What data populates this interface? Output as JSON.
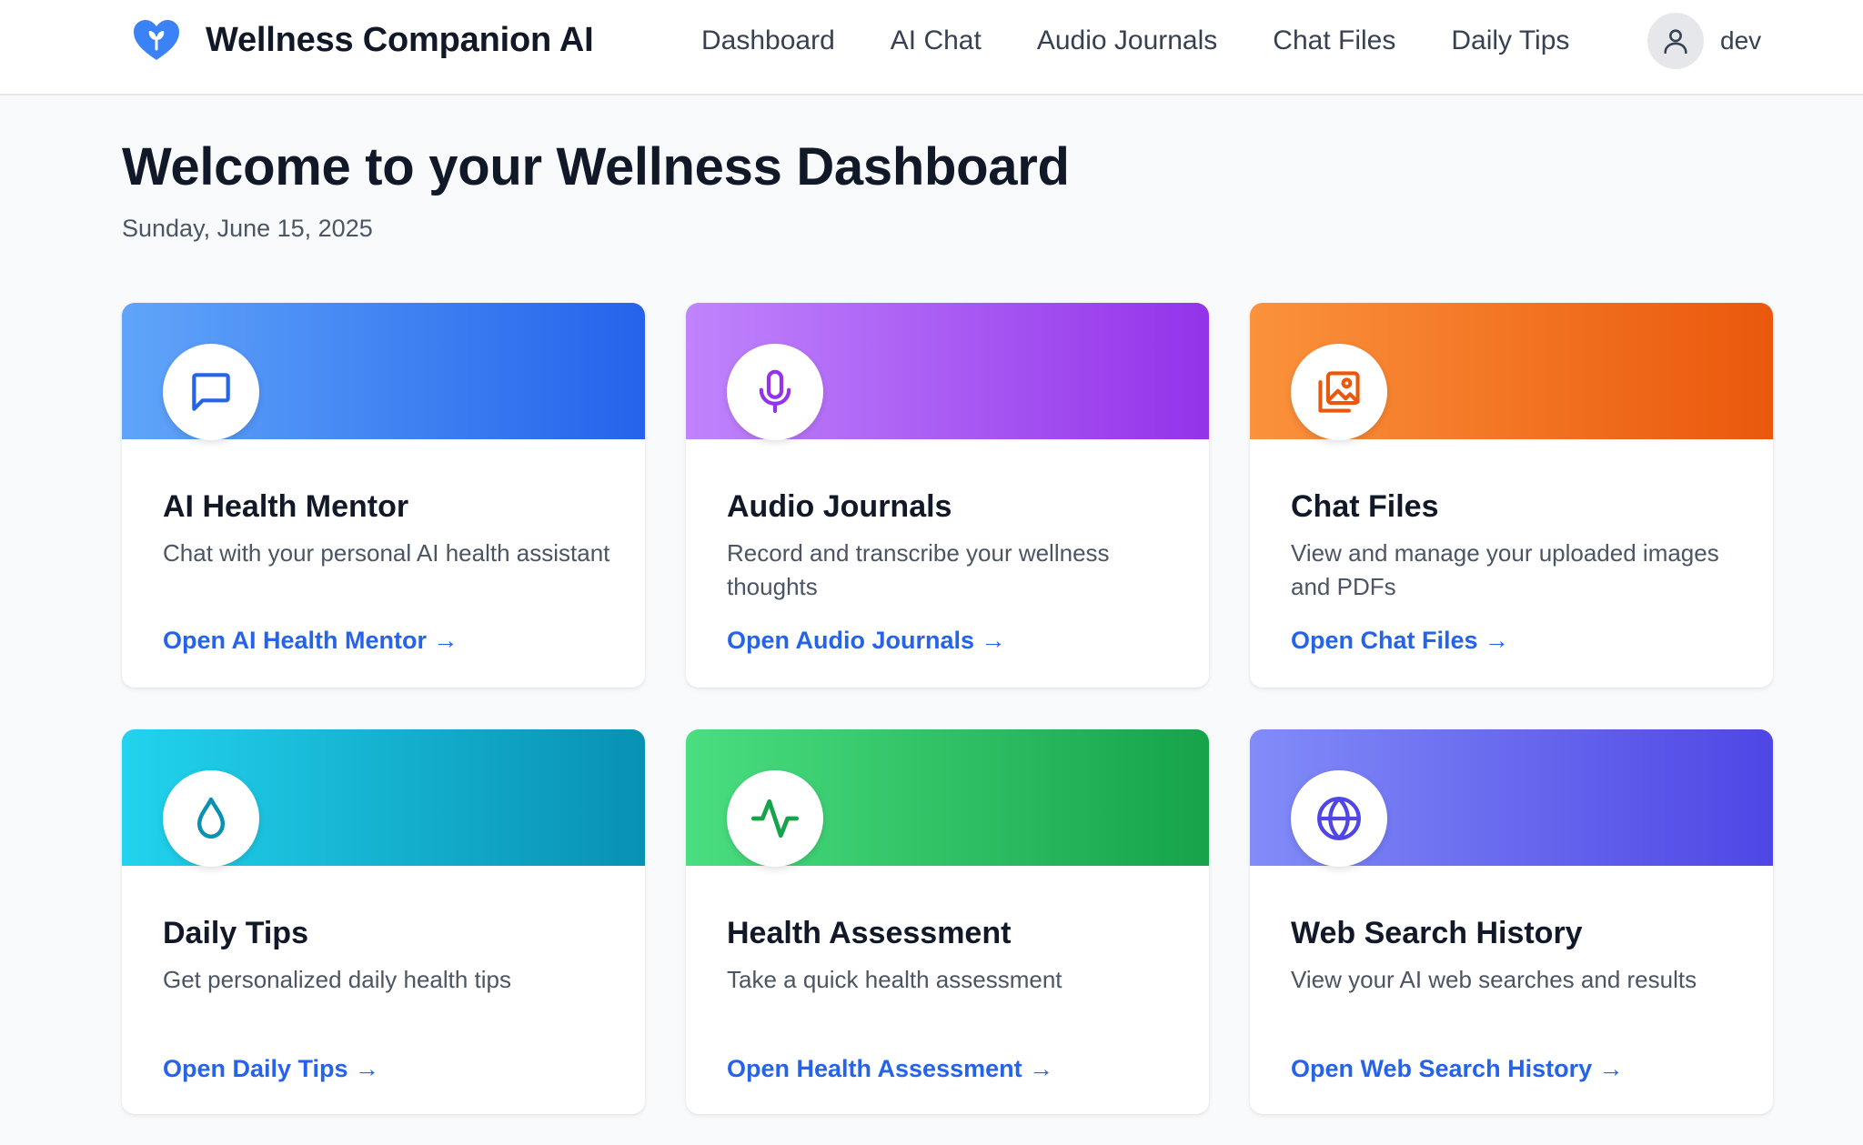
{
  "app": {
    "title": "Wellness Companion AI",
    "logo_icon": "heart-leaf-icon",
    "brand_color": "#3b82f6"
  },
  "nav": {
    "items": [
      {
        "label": "Dashboard"
      },
      {
        "label": "AI Chat"
      },
      {
        "label": "Audio Journals"
      },
      {
        "label": "Chat Files"
      },
      {
        "label": "Daily Tips"
      }
    ]
  },
  "user": {
    "name": "dev",
    "icon": "user-icon"
  },
  "page": {
    "title": "Welcome to your Wellness Dashboard",
    "date": "Sunday, June 15, 2025"
  },
  "cards": [
    {
      "title": "AI Health Mentor",
      "description": "Chat with your personal AI health assistant",
      "link": "Open AI Health Mentor →",
      "icon": "chat-bubble-icon",
      "color": "#2563eb"
    },
    {
      "title": "Audio Journals",
      "description": "Record and transcribe your wellness thoughts",
      "link": "Open Audio Journals →",
      "icon": "microphone-icon",
      "color": "#9333ea"
    },
    {
      "title": "Chat Files",
      "description": "View and manage your uploaded images and PDFs",
      "link": "Open Chat Files →",
      "icon": "image-gallery-icon",
      "color": "#ea580c"
    },
    {
      "title": "Daily Tips",
      "description": "Get personalized daily health tips",
      "link": "Open Daily Tips →",
      "icon": "water-drop-icon",
      "color": "#0891b2"
    },
    {
      "title": "Health Assessment",
      "description": "Take a quick health assessment",
      "link": "Open Health Assessment →",
      "icon": "activity-pulse-icon",
      "color": "#16a34a"
    },
    {
      "title": "Web Search History",
      "description": "View your AI web searches and results",
      "link": "Open Web Search History →",
      "icon": "globe-icon",
      "color": "#4f46e5"
    }
  ]
}
